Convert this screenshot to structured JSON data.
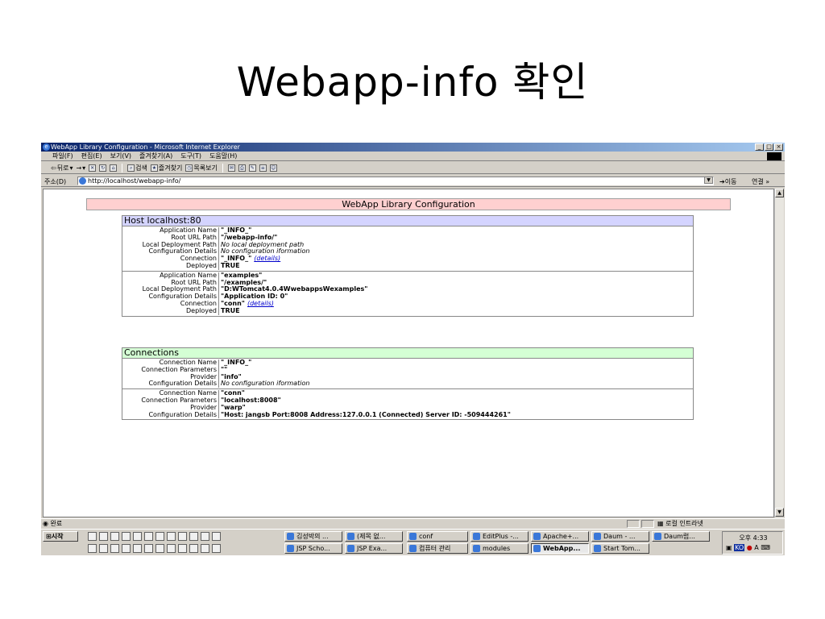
{
  "slide_title": "Webapp-info 확인",
  "window": {
    "title": "WebApp Library Configuration - Microsoft Internet Explorer",
    "menu": [
      "파일(F)",
      "편집(E)",
      "보기(V)",
      "즐겨찾기(A)",
      "도구(T)",
      "도움말(H)"
    ],
    "toolbar": {
      "back": "뒤로",
      "search": "검색",
      "favorites": "즐겨찾기",
      "history": "목록보기"
    },
    "address": {
      "label": "주소(D)",
      "url": "http://localhost/webapp-info/",
      "go": "이동",
      "links": "연결 »"
    }
  },
  "page": {
    "header": "WebApp Library Configuration",
    "host": {
      "heading": "Host localhost:80",
      "apps": [
        {
          "rows": [
            {
              "k": "Application Name",
              "v": "\"_INFO_\""
            },
            {
              "k": "Root URL Path",
              "v": "\"/webapp-info/\""
            },
            {
              "k": "Local Deployment Path",
              "v": "No local deployment path",
              "italic": true
            },
            {
              "k": "Configuration Details",
              "v": "No configuration iformation",
              "italic": true
            },
            {
              "k": "Connection",
              "v": "\"_INFO_\"",
              "link": "(details)"
            },
            {
              "k": "Deployed",
              "v": "TRUE"
            }
          ]
        },
        {
          "rows": [
            {
              "k": "Application Name",
              "v": "\"examples\""
            },
            {
              "k": "Root URL Path",
              "v": "\"/examples/\""
            },
            {
              "k": "Local Deployment Path",
              "v": "\"D:WTomcat4.0.4WwebappsWexamples\""
            },
            {
              "k": "Configuration Details",
              "v": "\"Application ID: 0\""
            },
            {
              "k": "Connection",
              "v": "\"conn\"",
              "link": "(details)"
            },
            {
              "k": "Deployed",
              "v": "TRUE"
            }
          ]
        }
      ]
    },
    "connections": {
      "heading": "Connections",
      "items": [
        {
          "rows": [
            {
              "k": "Connection Name",
              "v": "\"_INFO_\""
            },
            {
              "k": "Connection Parameters",
              "v": "\"\""
            },
            {
              "k": "Provider",
              "v": "\"info\""
            },
            {
              "k": "Configuration Details",
              "v": "No configuration iformation",
              "italic": true
            }
          ]
        },
        {
          "rows": [
            {
              "k": "Connection Name",
              "v": "\"conn\""
            },
            {
              "k": "Connection Parameters",
              "v": "\"localhost:8008\""
            },
            {
              "k": "Provider",
              "v": "\"warp\""
            },
            {
              "k": "Configuration Details",
              "v": "\"Host: jangsb Port:8008 Address:127.0.0.1 (Connected) Server ID: -509444261\""
            }
          ]
        }
      ]
    }
  },
  "status": {
    "text": "완료",
    "zone": "로컬 인트라넷"
  },
  "taskbar": {
    "start": "시작",
    "tasks_row1": [
      "김성박의 ...",
      "(제목 없...",
      "conf",
      "EditPlus -...",
      "Apache+...",
      "Daum - ...",
      "Daum럽..."
    ],
    "tasks_row2": [
      "JSP Scho...",
      "JSP Exa...",
      "컴퓨터 관리",
      "modules",
      "WebApp...",
      "Start Tom..."
    ],
    "clock": "오후 4:33",
    "ime": "KO"
  }
}
